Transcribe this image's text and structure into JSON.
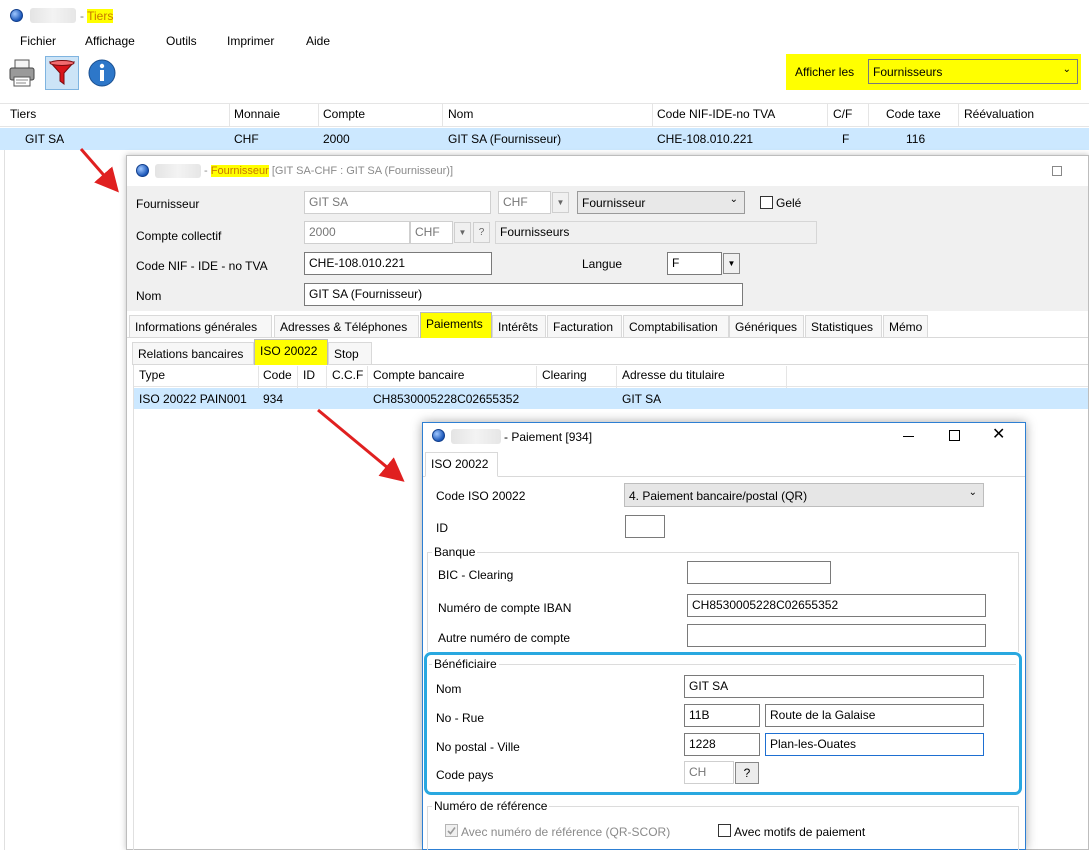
{
  "main": {
    "title_suffix": "- Tiers",
    "title_highlight": "Tiers",
    "menu": [
      "Fichier",
      "Affichage",
      "Outils",
      "Imprimer",
      "Aide"
    ],
    "afficher_label": "Afficher les",
    "afficher_value": "Fournisseurs",
    "columns": [
      "Tiers",
      "Monnaie",
      "Compte",
      "Nom",
      "Code NIF-IDE-no TVA",
      "C/F",
      "Code taxe",
      "Réévaluation"
    ],
    "row": {
      "tiers": "GIT SA",
      "monnaie": "CHF",
      "compte": "2000",
      "nom": "GIT SA (Fournisseur)",
      "code_nif": "CHE-108.010.221",
      "cf": "F",
      "code_taxe": "116",
      "reevaluation": ""
    }
  },
  "fournisseur_window": {
    "title_dash": "-",
    "title_highlight": "Fournisseur",
    "title_rest": "[GIT SA-CHF : GIT SA (Fournisseur)]",
    "fournisseur_label": "Fournisseur",
    "fournisseur_value": "GIT SA",
    "currency_value": "CHF",
    "type_value": "Fournisseur",
    "gele_label": "Gelé",
    "compte_label": "Compte collectif",
    "compte_value": "2000",
    "compte_currency": "CHF",
    "compte_help": "?",
    "compte_name": "Fournisseurs",
    "nif_label": "Code NIF - IDE - no TVA",
    "nif_value": "CHE-108.010.221",
    "langue_label": "Langue",
    "langue_value": "F",
    "nom_label": "Nom",
    "nom_value": "GIT SA (Fournisseur)",
    "tabs": [
      "Informations générales",
      "Adresses & Téléphones",
      "Paiements",
      "Intérêts",
      "Facturation",
      "Comptabilisation",
      "Génériques",
      "Statistiques",
      "Mémo"
    ],
    "subtabs": [
      "Relations bancaires",
      "ISO 20022",
      "Stop"
    ],
    "grid_columns": [
      "Type",
      "Code",
      "ID",
      "C.C.F",
      "Compte bancaire",
      "Clearing",
      "Adresse du titulaire"
    ],
    "grid_row": {
      "type": "ISO 20022 PAIN001",
      "code": "934",
      "id": "",
      "ccf": "",
      "compte": "CH8530005228C02655352",
      "clearing": "",
      "adresse": "GIT SA"
    }
  },
  "paiement_window": {
    "title": "- Paiement [934]",
    "tab": "ISO 20022",
    "code_iso_label": "Code ISO 20022",
    "code_iso_value": "4. Paiement bancaire/postal (QR)",
    "id_label": "ID",
    "id_value": "",
    "banque_group": "Banque",
    "bic_label": "BIC - Clearing",
    "bic_value": "",
    "iban_label": "Numéro de compte IBAN",
    "iban_value": "CH8530005228C02655352",
    "autre_label": "Autre numéro de compte",
    "autre_value": "",
    "beneficiaire_group": "Bénéficiaire",
    "nom_label": "Nom",
    "nom_value": "GIT SA",
    "rue_label": "No - Rue",
    "rue_no": "11B",
    "rue_value": "Route de la Galaise",
    "ville_label": "No postal - Ville",
    "postal_value": "1228",
    "ville_value": "Plan-les-Ouates",
    "pays_label": "Code pays",
    "pays_value": "CH",
    "pays_help": "?",
    "reference_group": "Numéro de référence",
    "ref_qr_label": "Avec numéro de référence (QR-SCOR)",
    "ref_motifs_label": "Avec motifs de paiement"
  },
  "colors": {
    "highlight": "#ffff00",
    "selection": "#cce8ff",
    "annotation_blue": "#29a8e0",
    "arrow_red": "#e02020"
  }
}
